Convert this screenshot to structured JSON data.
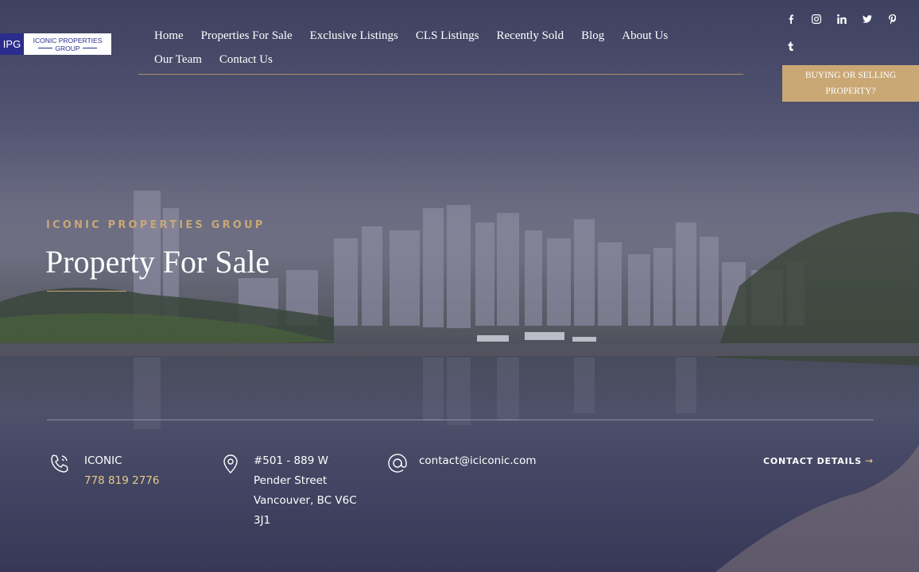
{
  "brand": {
    "logo_mark": "IPG",
    "logo_line1": "ICONIC PROPERTIES",
    "logo_line2": "GROUP"
  },
  "nav": {
    "row1": [
      "Home",
      "Properties For Sale",
      "Exclusive Listings",
      "CLS Listings",
      "Recently Sold",
      "Blog",
      "About Us"
    ],
    "row2": [
      "Our Team",
      "Contact Us"
    ]
  },
  "social": {
    "icons": [
      "facebook-icon",
      "instagram-icon",
      "linkedin-icon",
      "twitter-icon",
      "pinterest-icon",
      "tumblr-icon"
    ]
  },
  "cta": {
    "label": "BUYING OR SELLING PROPERTY?"
  },
  "hero": {
    "eyebrow": "ICONIC PROPERTIES GROUP",
    "title": "Property For Sale"
  },
  "contact": {
    "phone_name": "ICONIC",
    "phone_number": "778 819 2776",
    "address_line1": "#501 - 889 W",
    "address_line2": "Pender Street",
    "address_line3": "Vancouver, BC V6C",
    "address_line4": "3J1",
    "email": "contact@iciconic.com",
    "details_label": "CONTACT DETAILS",
    "details_arrow": "→"
  },
  "colors": {
    "accent_gold": "#c9a876",
    "logo_navy": "#2a2d8c"
  }
}
